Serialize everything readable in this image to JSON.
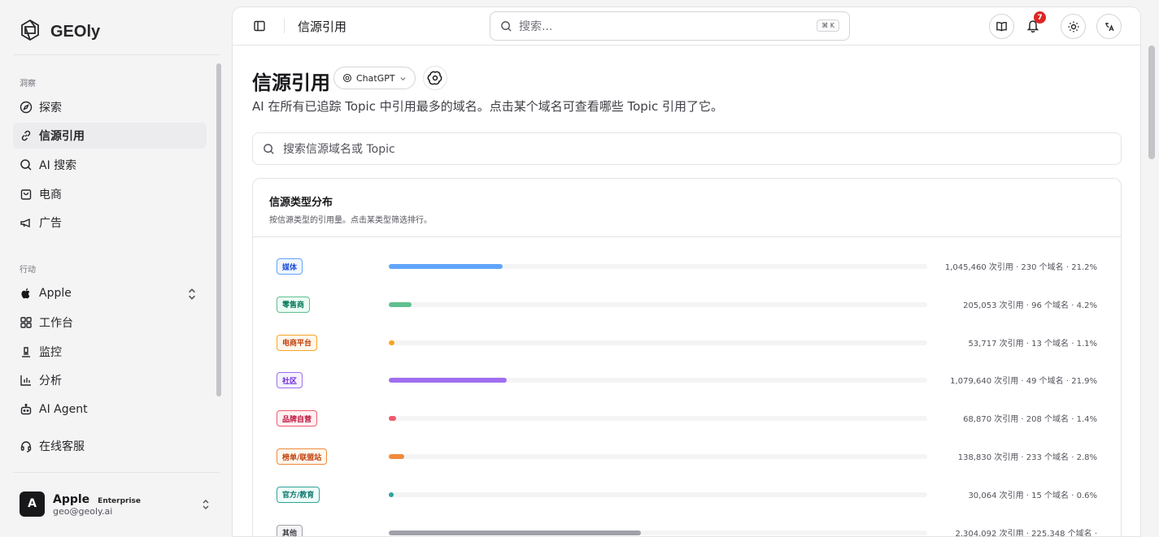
{
  "sidebar": {
    "brand": "GEOly",
    "group_insights": "洞察",
    "insights": [
      {
        "label": "探索",
        "icon": "compass-icon"
      },
      {
        "label": "信源引用",
        "icon": "link-icon",
        "active": true
      },
      {
        "label": "AI 搜索",
        "icon": "search-icon"
      },
      {
        "label": "电商",
        "icon": "shopping-bag-icon"
      },
      {
        "label": "广告",
        "icon": "megaphone-icon"
      }
    ],
    "group_actions": "行动",
    "brand_selector": "Apple",
    "actions": [
      {
        "label": "工作台",
        "icon": "grid-icon"
      },
      {
        "label": "监控",
        "icon": "monitor-icon"
      },
      {
        "label": "分析",
        "icon": "bar-chart-icon"
      },
      {
        "label": "AI Agent",
        "icon": "bot-icon"
      }
    ],
    "support": "在线客服",
    "user": {
      "initial": "A",
      "name": "Apple",
      "plan": "Enterprise",
      "email": "geo@geoly.ai"
    }
  },
  "topbar": {
    "breadcrumb": "信源引用",
    "search_placeholder": "搜索...",
    "shortcut": "⌘ K",
    "notification_count": "7"
  },
  "page": {
    "title": "信源引用",
    "model": "ChatGPT",
    "subtitle": "AI 在所有已追踪 Topic 中引用最多的域名。点击某个域名可查看哪些 Topic 引用了它。",
    "filter_placeholder": "搜索信源域名或 Topic"
  },
  "distribution": {
    "title": "信源类型分布",
    "description": "按信源类型的引用量。点击某类型筛选排行。",
    "rows": [
      {
        "label": "媒体",
        "stats": "1,045,460 次引用 · 230 个域名 · 21.2%",
        "share": 0.212,
        "color": "#60a5fa",
        "bg": "#eff6ff",
        "fg": "#1d4ed8"
      },
      {
        "label": "零售商",
        "stats": "205,053 次引用 · 96 个域名 · 4.2%",
        "share": 0.042,
        "color": "#5fbf8f",
        "bg": "#ecfdf5",
        "fg": "#047857"
      },
      {
        "label": "电商平台",
        "stats": "53,717 次引用 · 13 个域名 · 1.1%",
        "share": 0.011,
        "color": "#f5a623",
        "bg": "#fff7ed",
        "fg": "#c2410c"
      },
      {
        "label": "社区",
        "stats": "1,079,640 次引用 · 49 个域名 · 21.9%",
        "share": 0.219,
        "color": "#9f6ef0",
        "bg": "#f5f3ff",
        "fg": "#6d28d9"
      },
      {
        "label": "品牌自营",
        "stats": "68,870 次引用 · 208 个域名 · 1.4%",
        "share": 0.014,
        "color": "#ef5a6f",
        "bg": "#fff1f2",
        "fg": "#be123c"
      },
      {
        "label": "榜单/联盟站",
        "stats": "138,830 次引用 · 233 个域名 · 2.8%",
        "share": 0.028,
        "color": "#f08a3c",
        "bg": "#fff7ed",
        "fg": "#c2410c"
      },
      {
        "label": "官方/教育",
        "stats": "30,064 次引用 · 15 个域名 · 0.6%",
        "share": 0.006,
        "color": "#2fa39a",
        "bg": "#f0fdfa",
        "fg": "#0f766e"
      },
      {
        "label": "其他",
        "stats": "2,304,092 次引用 · 225,348 个域名 ·",
        "share": 0.468,
        "color": "#a1a1aa",
        "bg": "#f4f4f5",
        "fg": "#3f3f46"
      }
    ]
  }
}
